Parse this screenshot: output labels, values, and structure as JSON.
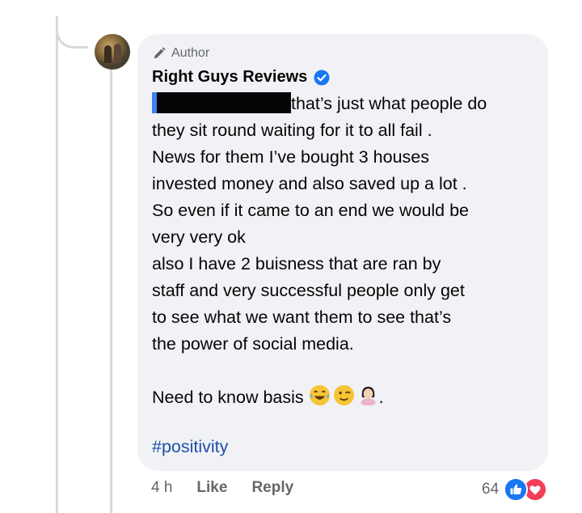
{
  "comment": {
    "author_badge": "Author",
    "author_name": "Right Guys Reviews",
    "body_first_line": "that’s just what people do",
    "body_rest": "they sit round waiting for it to all fail .\nNews for them I’ve bought 3 houses\ninvested money and also saved up a lot .\nSo even if it came to an end we would be\nvery very ok\n also I have 2 buisness  that are ran by\nstaff and very successful  people only get\nto see what we want them to see that’s\nthe power of social media.\n\nNeed to know basis",
    "trailing_punct": ".",
    "hashtag": "#positivity",
    "timestamp": "4 h",
    "like_label": "Like",
    "reply_label": "Reply",
    "reaction_count": "64",
    "emoji_names": [
      "tears-of-joy-emoji",
      "winking-face-emoji",
      "woman-facepalming-emoji"
    ]
  },
  "colors": {
    "bubble_bg": "#f0f2f5",
    "hashtag": "#1f4fa8",
    "secondary_text": "#65676b",
    "verified_blue": "#1877f2",
    "love_red": "#f33e58"
  }
}
